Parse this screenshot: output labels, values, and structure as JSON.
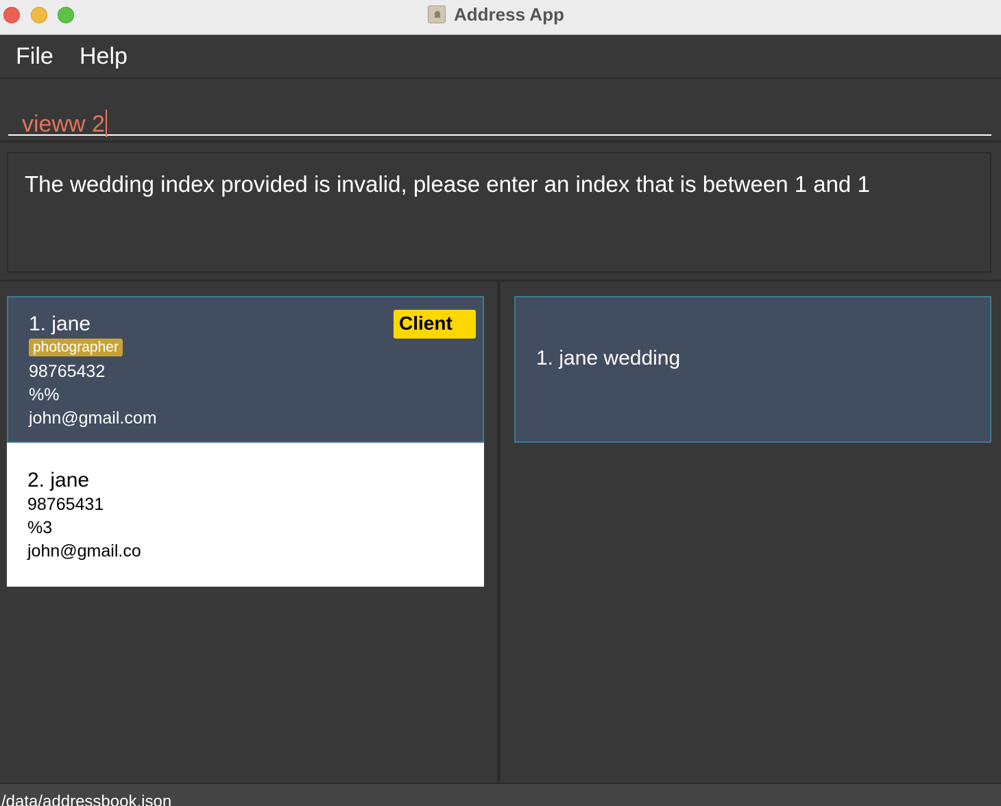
{
  "window": {
    "title": "Address App",
    "icon": "address-book-icon"
  },
  "menu": {
    "items": [
      {
        "label": "File"
      },
      {
        "label": "Help"
      }
    ]
  },
  "command": {
    "value": "vieww 2"
  },
  "result": {
    "message": "The wedding index provided is invalid, please enter an index that is between 1 and 1"
  },
  "persons": [
    {
      "name": "1. jane",
      "tags": [
        "photographer"
      ],
      "badge": "Client",
      "phone": "98765432",
      "address": "%%",
      "email": "john@gmail.com",
      "selected": true
    },
    {
      "name": "2. jane",
      "tags": [],
      "phone": "98765431",
      "address": "%3",
      "email": "john@gmail.co",
      "selected": false
    }
  ],
  "weddings": [
    {
      "label": "1. jane wedding",
      "selected": true
    }
  ],
  "status": {
    "path": "/data/addressbook.json"
  },
  "colors": {
    "background": "#383838",
    "selected_card": "#424d5f",
    "command_text": "#e0765e",
    "tag": "#c9a236",
    "client_badge": "#ffd700"
  }
}
